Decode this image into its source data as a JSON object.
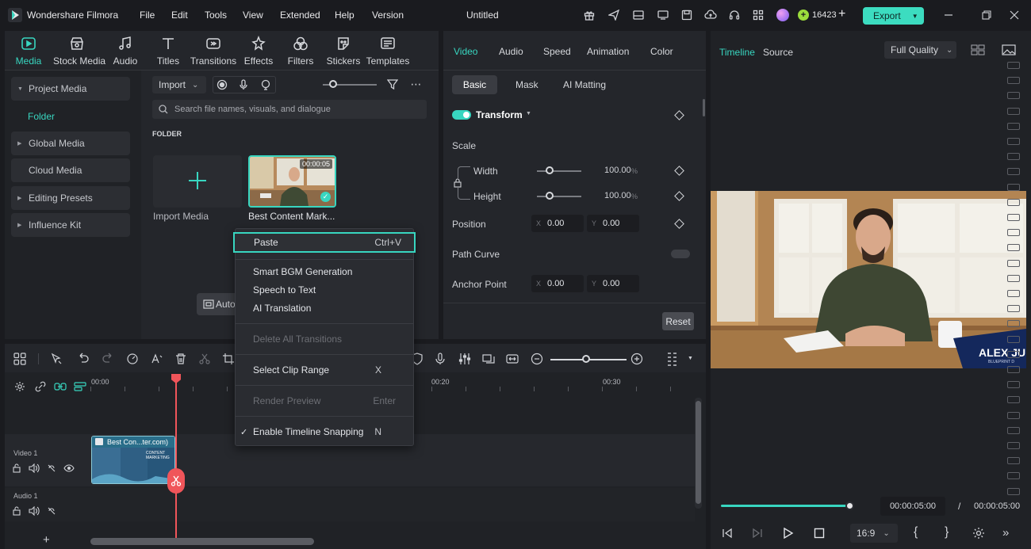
{
  "app": {
    "name": "Wondershare Filmora",
    "project_title": "Untitled",
    "credits": "16423",
    "export_label": "Export"
  },
  "menubar": [
    "File",
    "Edit",
    "Tools",
    "View",
    "Extended",
    "Help",
    "Version"
  ],
  "toolbar": [
    "Media",
    "Stock Media",
    "Audio",
    "Titles",
    "Transitions",
    "Effects",
    "Filters",
    "Stickers",
    "Templates"
  ],
  "sidebar": {
    "project_media": "Project Media",
    "folder": "Folder",
    "global_media": "Global Media",
    "cloud_media": "Cloud Media",
    "editing_presets": "Editing Presets",
    "influence_kit": "Influence Kit"
  },
  "media": {
    "import_label": "Import",
    "search_placeholder": "Search file names, visuals, and dialogue",
    "folder_header": "FOLDER",
    "import_media": "Import Media",
    "clip_name": "Best Content Mark...",
    "clip_duration": "00:00:05",
    "auto_button": "Auto"
  },
  "context_menu": {
    "paste": "Paste",
    "paste_key": "Ctrl+V",
    "smart_bgm": "Smart BGM Generation",
    "speech_to_text": "Speech to Text",
    "ai_translation": "AI Translation",
    "delete_transitions": "Delete All Transitions",
    "select_clip_range": "Select Clip Range",
    "select_clip_key": "X",
    "render_preview": "Render Preview",
    "render_key": "Enter",
    "enable_snapping": "Enable Timeline Snapping",
    "snapping_key": "N"
  },
  "properties": {
    "tabs": [
      "Video",
      "Audio",
      "Speed",
      "Animation",
      "Color"
    ],
    "subtabs": [
      "Basic",
      "Mask",
      "AI Matting"
    ],
    "transform": "Transform",
    "scale": "Scale",
    "width": "Width",
    "width_value": "100.00",
    "height": "Height",
    "height_value": "100.00",
    "percent": "%",
    "position": "Position",
    "pos_x": "0.00",
    "pos_y": "0.00",
    "path_curve": "Path Curve",
    "anchor_point": "Anchor Point",
    "anchor_x": "0.00",
    "anchor_y": "0.00",
    "x_label": "X",
    "y_label": "Y",
    "reset": "Reset"
  },
  "preview": {
    "tabs": [
      "Timeline",
      "Source"
    ],
    "quality": "Full Quality",
    "current_time": "00:00:05:00",
    "separator": "/",
    "total_time": "00:00:05:00",
    "aspect": "16:9",
    "overlay_name": "ALEX JU",
    "overlay_sub": "BLUEPRINT D"
  },
  "timeline": {
    "ruler": [
      "00:00",
      "00:20",
      "00:30"
    ],
    "video_track": "Video 1",
    "audio_track": "Audio 1",
    "clip_label": "Best Con...ter.com)",
    "clip_thumb_text": "CONTENT MARKETING",
    "add_track": "+"
  },
  "colors": {
    "accent": "#38d6c0",
    "playhead": "#f0555a",
    "bg": "#1a1b1f",
    "panel": "#24262b"
  }
}
